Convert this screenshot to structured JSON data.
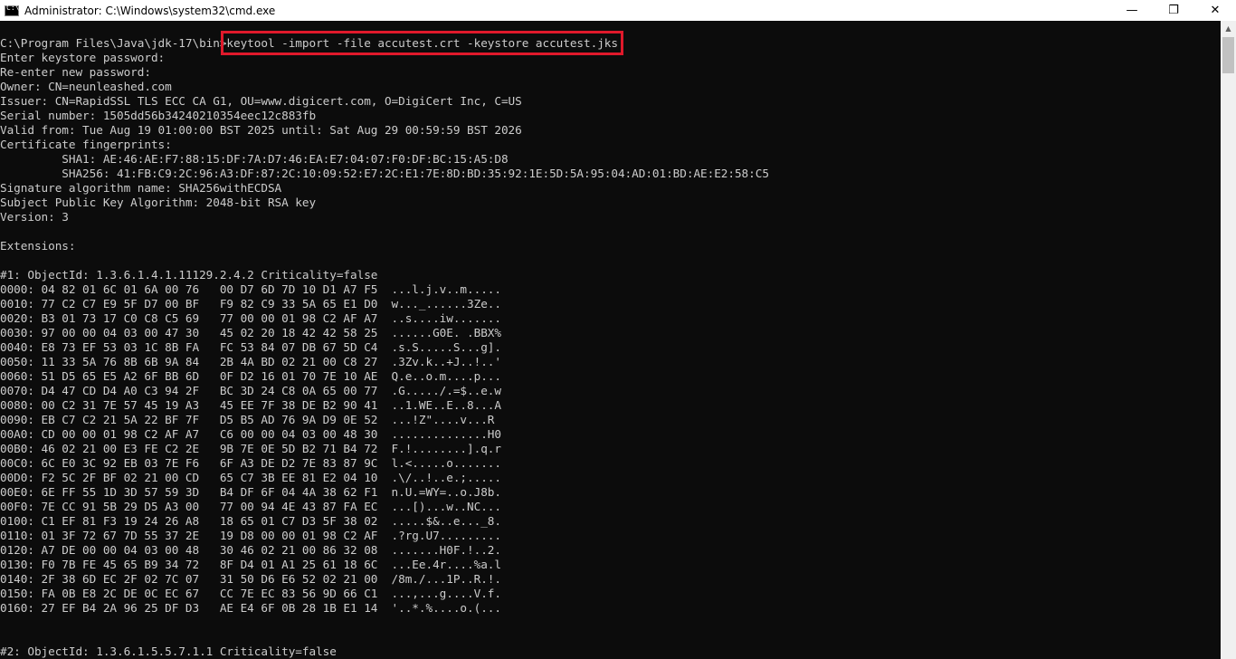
{
  "window": {
    "title": "Administrator: C:\\Windows\\system32\\cmd.exe",
    "icon": "cmd-icon",
    "controls": {
      "minimize": "—",
      "restore": "❐",
      "close": "✕"
    }
  },
  "console": {
    "prompt": "C:\\Program Files\\Java\\jdk-17\\bin>",
    "command": "keytool -import -file accutest.crt -keystore accutest.jks",
    "lines": [
      "Enter keystore password:",
      "Re-enter new password:",
      "Owner: CN=neunleashed.com",
      "Issuer: CN=RapidSSL TLS ECC CA G1, OU=www.digicert.com, O=DigiCert Inc, C=US",
      "Serial number: 1505dd56b34240210354eec12c883fb",
      "Valid from: Tue Aug 19 01:00:00 BST 2025 until: Sat Aug 29 00:59:59 BST 2026",
      "Certificate fingerprints:",
      "         SHA1: AE:46:AE:F7:88:15:DF:7A:D7:46:EA:E7:04:07:F0:DF:BC:15:A5:D8",
      "         SHA256: 41:FB:C9:2C:96:A3:DF:87:2C:10:09:52:E7:2C:E1:7E:8D:BD:35:92:1E:5D:5A:95:04:AD:01:BD:AE:E2:58:C5",
      "Signature algorithm name: SHA256withECDSA",
      "Subject Public Key Algorithm: 2048-bit RSA key",
      "Version: 3",
      "",
      "Extensions:",
      "",
      "#1: ObjectId: 1.3.6.1.4.1.11129.2.4.2 Criticality=false",
      "0000: 04 82 01 6C 01 6A 00 76   00 D7 6D 7D 10 D1 A7 F5  ...l.j.v..m.....",
      "0010: 77 C2 C7 E9 5F D7 00 BF   F9 82 C9 33 5A 65 E1 D0  w..._......3Ze..",
      "0020: B3 01 73 17 C0 C8 C5 69   77 00 00 01 98 C2 AF A7  ..s....iw.......",
      "0030: 97 00 00 04 03 00 47 30   45 02 20 18 42 42 58 25  ......G0E. .BBX%",
      "0040: E8 73 EF 53 03 1C 8B FA   FC 53 84 07 DB 67 5D C4  .s.S.....S...g].",
      "0050: 11 33 5A 76 8B 6B 9A 84   2B 4A BD 02 21 00 C8 27  .3Zv.k..+J..!..'",
      "0060: 51 D5 65 E5 A2 6F BB 6D   0F D2 16 01 70 7E 10 AE  Q.e..o.m....p...",
      "0070: D4 47 CD D4 A0 C3 94 2F   BC 3D 24 C8 0A 65 00 77  .G...../.=$..e.w",
      "0080: 00 C2 31 7E 57 45 19 A3   45 EE 7F 38 DE B2 90 41  ..1.WE..E..8...A",
      "0090: EB C7 C2 21 5A 22 BF 7F   D5 B5 AD 76 9A D9 0E 52  ...!Z\"....v...R",
      "00A0: CD 00 00 01 98 C2 AF A7   C6 00 00 04 03 00 48 30  ..............H0",
      "00B0: 46 02 21 00 E3 FE C2 2E   9B 7E 0E 5D B2 71 B4 72  F.!........].q.r",
      "00C0: 6C E0 3C 92 EB 03 7E F6   6F A3 DE D2 7E 83 87 9C  l.<.....o.......",
      "00D0: F2 5C 2F BF 02 21 00 CD   65 C7 3B EE 81 E2 04 10  .\\/..!..e.;.....",
      "00E0: 6E FF 55 1D 3D 57 59 3D   B4 DF 6F 04 4A 38 62 F1  n.U.=WY=..o.J8b.",
      "00F0: 7E CC 91 5B 29 D5 A3 00   77 00 94 4E 43 87 FA EC  ...[)...w..NC...",
      "0100: C1 EF 81 F3 19 24 26 A8   18 65 01 C7 D3 5F 38 02  .....$&..e..._8.",
      "0110: 01 3F 72 67 7D 55 37 2E   19 D8 00 00 01 98 C2 AF  .?rg.U7.........",
      "0120: A7 DE 00 00 04 03 00 48   30 46 02 21 00 86 32 08  .......H0F.!..2.",
      "0130: F0 7B FE 45 65 B9 34 72   8F D4 01 A1 25 61 18 6C  ...Ee.4r....%a.l",
      "0140: 2F 38 6D EC 2F 02 7C 07   31 50 D6 E6 52 02 21 00  /8m./...1P..R.!.",
      "0150: FA 0B E8 2C DE 0C EC 67   CC 7E EC 83 56 9D 66 C1  ...,...g....V.f.",
      "0160: 27 EF B4 2A 96 25 DF D3   AE E4 6F 0B 28 1B E1 14  '..*.%....o.(...",
      "",
      "",
      "#2: ObjectId: 1.3.6.1.5.5.7.1.1 Criticality=false"
    ]
  },
  "colors": {
    "console_bg": "#0c0c0c",
    "console_fg": "#cccccc",
    "highlight": "#e0192b"
  }
}
